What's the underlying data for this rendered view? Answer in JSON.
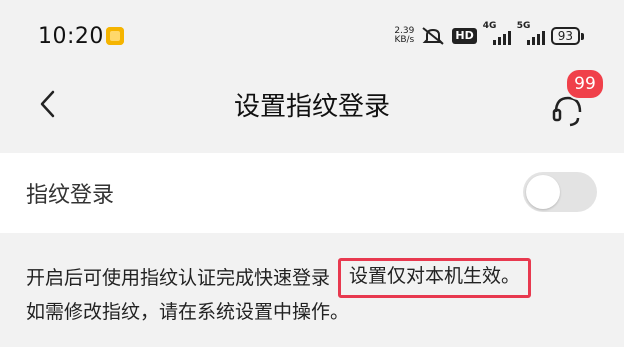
{
  "status_bar": {
    "time": "10:20",
    "net_speed_value": "2.39",
    "net_speed_unit": "KB/s",
    "hd_label": "HD",
    "sim1_label": "4G",
    "sim2_label": "5G",
    "battery": "93"
  },
  "nav": {
    "title": "设置指纹登录",
    "badge_count": "99"
  },
  "settings": {
    "fingerprint_login_label": "指纹登录",
    "toggle_state": "off"
  },
  "description": {
    "line1_text": "开启后可使用指纹认证完成快速登录",
    "line1_highlight": "设置仅对本机生效。",
    "line2_text": "如需修改指纹，请在系统设置中操作。"
  },
  "colors": {
    "background": "#f2f2f2",
    "card": "#ffffff",
    "badge": "#f0404a",
    "highlight_border": "#e8394f",
    "toggle_off": "#e3e3e3"
  }
}
